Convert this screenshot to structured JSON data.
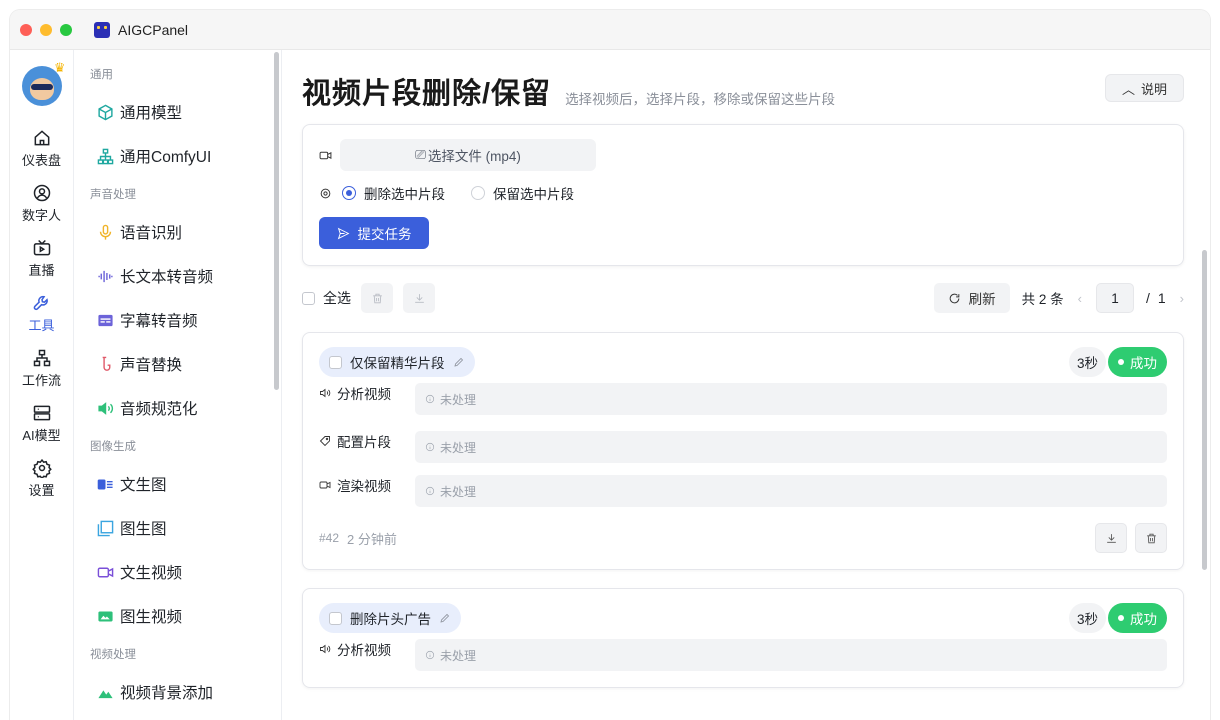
{
  "window": {
    "title": "AIGCPanel"
  },
  "rail": {
    "items": [
      {
        "label": "仪表盘",
        "icon": "home-icon"
      },
      {
        "label": "数字人",
        "icon": "user-circle-icon"
      },
      {
        "label": "直播",
        "icon": "tv-icon"
      },
      {
        "label": "工具",
        "icon": "wrench-icon",
        "active": true
      },
      {
        "label": "工作流",
        "icon": "workflow-icon"
      },
      {
        "label": "AI模型",
        "icon": "server-icon"
      },
      {
        "label": "设置",
        "icon": "gear-icon"
      }
    ]
  },
  "sidebar": {
    "groups": [
      {
        "title": "通用",
        "items": [
          {
            "label": "通用模型",
            "icon": "cube-icon"
          },
          {
            "label": "通用ComfyUI",
            "icon": "hierarchy-icon"
          }
        ]
      },
      {
        "title": "声音处理",
        "items": [
          {
            "label": "语音识别",
            "icon": "microphone-icon"
          },
          {
            "label": "长文本转音频",
            "icon": "waveform-icon"
          },
          {
            "label": "字幕转音频",
            "icon": "subtitle-icon"
          },
          {
            "label": "声音替换",
            "icon": "saxophone-icon"
          },
          {
            "label": "音频规范化",
            "icon": "speaker-icon"
          }
        ]
      },
      {
        "title": "图像生成",
        "items": [
          {
            "label": "文生图",
            "icon": "text-image-icon"
          },
          {
            "label": "图生图",
            "icon": "image-copy-icon"
          },
          {
            "label": "文生视频",
            "icon": "video-camera-icon"
          },
          {
            "label": "图生视频",
            "icon": "image-video-icon"
          }
        ]
      },
      {
        "title": "视频处理",
        "items": [
          {
            "label": "视频背景添加",
            "icon": "mountain-icon"
          }
        ]
      }
    ]
  },
  "page": {
    "title": "视频片段删除/保留",
    "subtitle": "选择视频后，选择片段，移除或保留这些片段",
    "help_label": "说明"
  },
  "form": {
    "file_button": "选择文件 (mp4)",
    "radio_delete": "删除选中片段",
    "radio_keep": "保留选中片段",
    "submit": "提交任务"
  },
  "toolbar": {
    "select_all": "全选",
    "refresh": "刷新",
    "total": "共 2 条",
    "page_current": "1",
    "page_sep": "/",
    "page_total": "1"
  },
  "tasks": [
    {
      "title": "仅保留精华片段",
      "duration": "3秒",
      "status": "成功",
      "steps": [
        {
          "label": "分析视频",
          "value": "未处理"
        },
        {
          "label": "配置片段",
          "value": "未处理"
        },
        {
          "label": "渲染视频",
          "value": "未处理"
        }
      ],
      "id": "#42",
      "time": "2 分钟前"
    },
    {
      "title": "删除片头广告",
      "duration": "3秒",
      "status": "成功",
      "steps": [
        {
          "label": "分析视频",
          "value": "未处理"
        }
      ]
    }
  ],
  "colors": {
    "accent": "#3b5fdb",
    "success": "#2ecc71"
  }
}
